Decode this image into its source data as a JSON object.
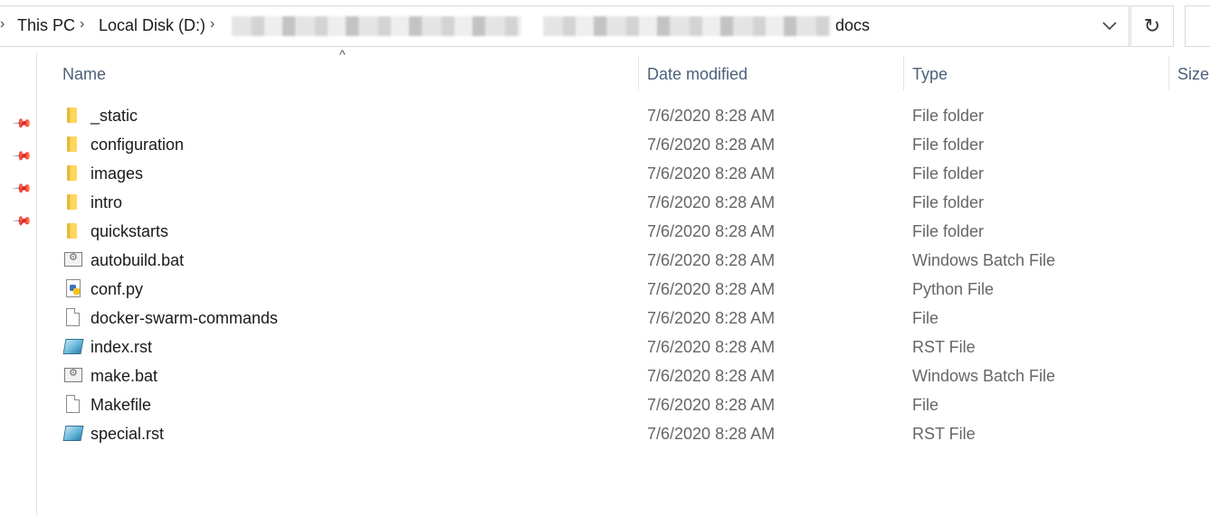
{
  "address": {
    "crumbs": [
      "This PC",
      "Local Disk (D:)",
      "docs"
    ],
    "refresh_icon": "↻",
    "dropdown_icon": "chevron-down-icon"
  },
  "columns": {
    "name": "Name",
    "date": "Date modified",
    "type": "Type",
    "size": "Size"
  },
  "files": [
    {
      "name": "_static",
      "date": "7/6/2020 8:28 AM",
      "type": "File folder",
      "icon": "folder-icon"
    },
    {
      "name": "configuration",
      "date": "7/6/2020 8:28 AM",
      "type": "File folder",
      "icon": "folder-icon"
    },
    {
      "name": "images",
      "date": "7/6/2020 8:28 AM",
      "type": "File folder",
      "icon": "folder-icon"
    },
    {
      "name": "intro",
      "date": "7/6/2020 8:28 AM",
      "type": "File folder",
      "icon": "folder-icon"
    },
    {
      "name": "quickstarts",
      "date": "7/6/2020 8:28 AM",
      "type": "File folder",
      "icon": "folder-icon"
    },
    {
      "name": "autobuild.bat",
      "date": "7/6/2020 8:28 AM",
      "type": "Windows Batch File",
      "icon": "batch-file-icon"
    },
    {
      "name": "conf.py",
      "date": "7/6/2020 8:28 AM",
      "type": "Python File",
      "icon": "python-file-icon"
    },
    {
      "name": "docker-swarm-commands",
      "date": "7/6/2020 8:28 AM",
      "type": "File",
      "icon": "file-icon"
    },
    {
      "name": "index.rst",
      "date": "7/6/2020 8:28 AM",
      "type": "RST File",
      "icon": "rst-file-icon"
    },
    {
      "name": "make.bat",
      "date": "7/6/2020 8:28 AM",
      "type": "Windows Batch File",
      "icon": "batch-file-icon"
    },
    {
      "name": "Makefile",
      "date": "7/6/2020 8:28 AM",
      "type": "File",
      "icon": "file-icon"
    },
    {
      "name": "special.rst",
      "date": "7/6/2020 8:28 AM",
      "type": "RST File",
      "icon": "rst-file-icon"
    }
  ]
}
